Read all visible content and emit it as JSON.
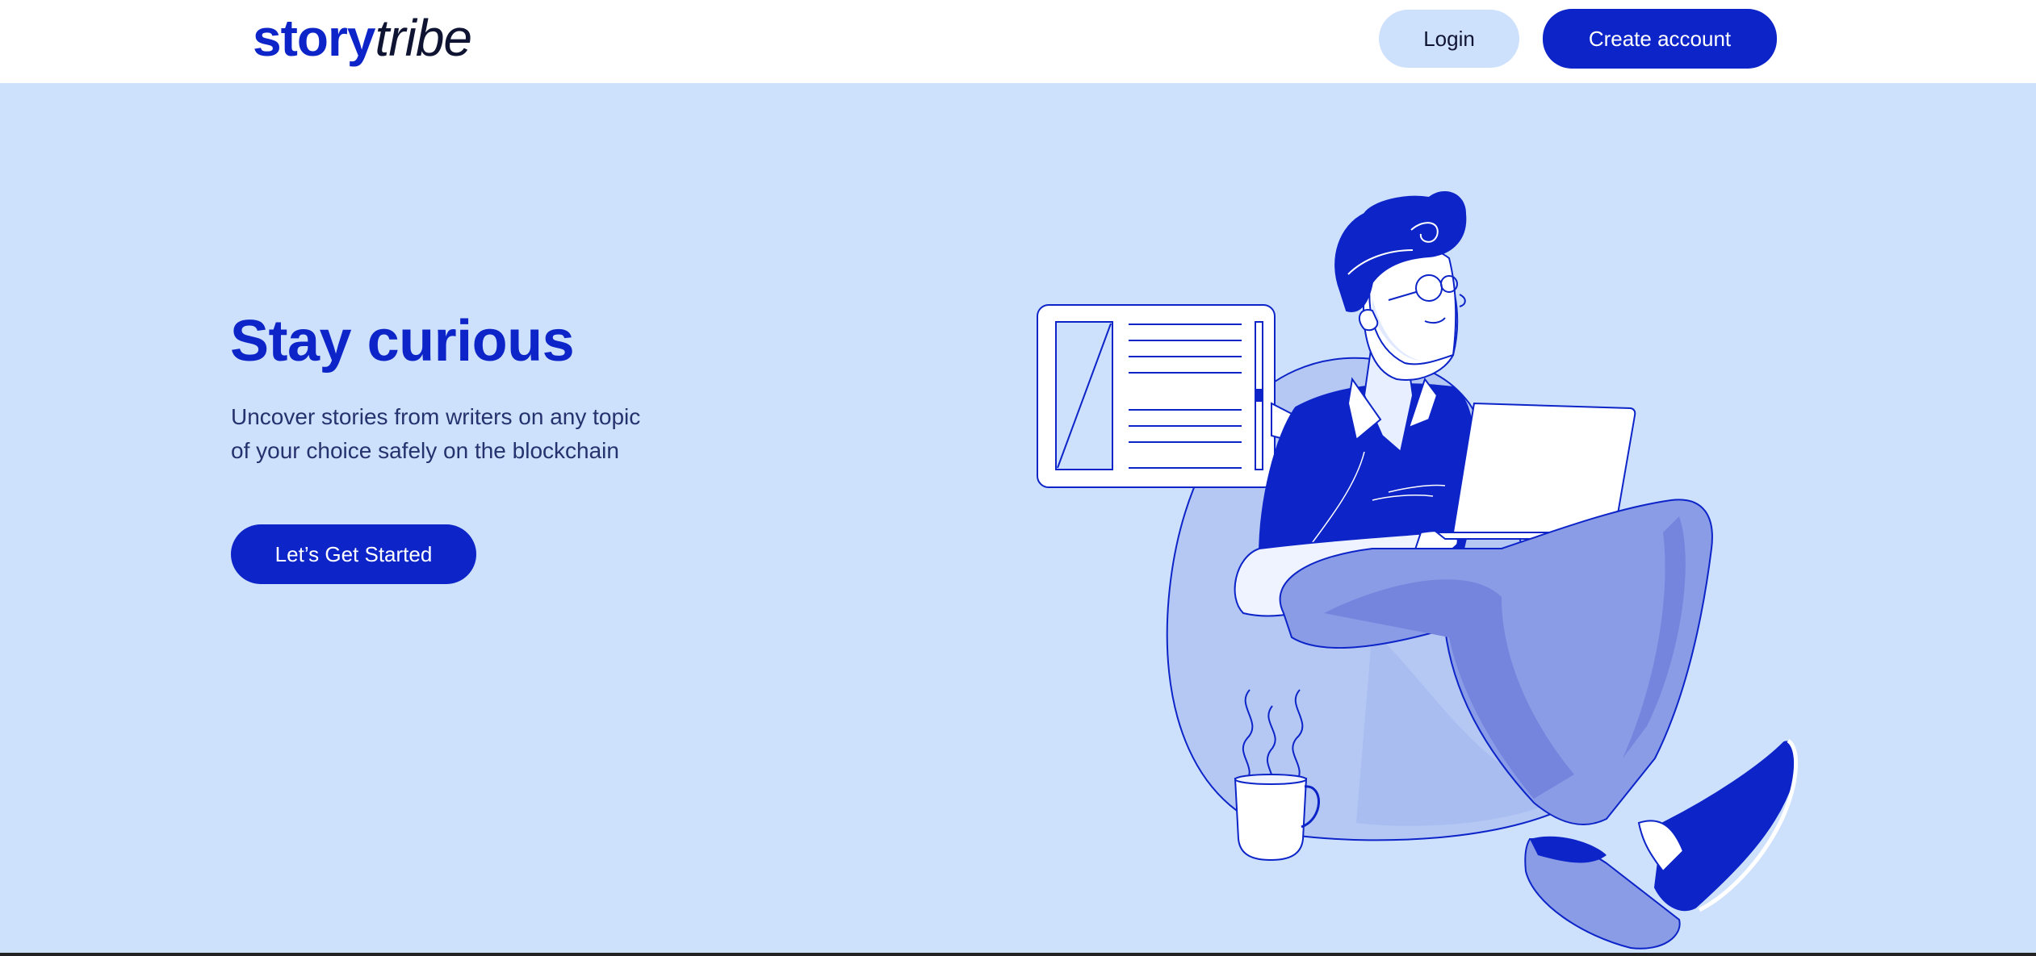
{
  "header": {
    "logo": {
      "part_bold": "story",
      "part_italic": "tribe"
    },
    "login_label": "Login",
    "create_account_label": "Create account"
  },
  "hero": {
    "title": "Stay curious",
    "subtitle_line1": "Uncover stories from writers on any topic",
    "subtitle_line2": "of your choice safely on the blockchain",
    "cta_label": "Let’s Get Started"
  },
  "colors": {
    "brand_blue": "#0c24c8",
    "hero_background": "#cde0fc",
    "header_background": "#ffffff",
    "dark_text": "#0f1432"
  },
  "illustration": {
    "icon": "person-reading-laptop-illustration"
  }
}
